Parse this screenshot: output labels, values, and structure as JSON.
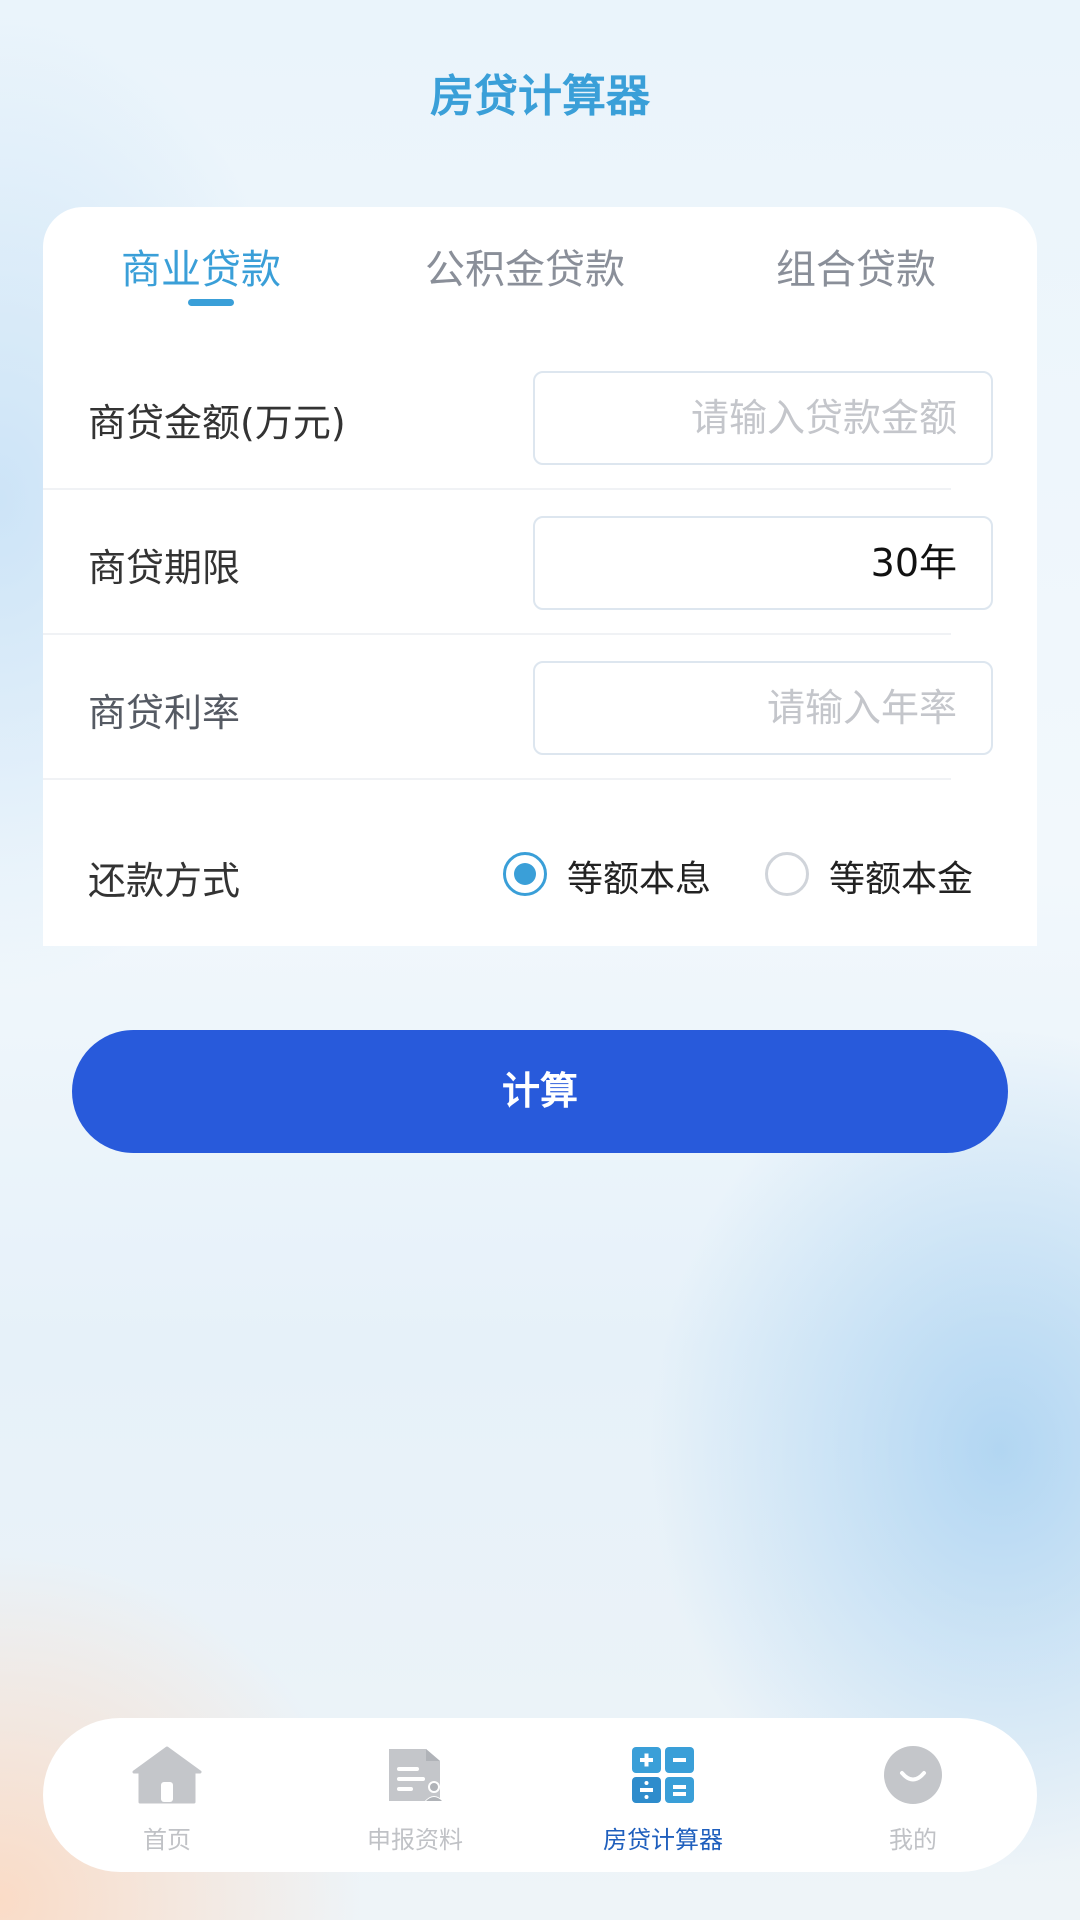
{
  "header": {
    "title": "房贷计算器"
  },
  "tabs": [
    {
      "label": "商业贷款",
      "active": true
    },
    {
      "label": "公积金贷款",
      "active": false
    },
    {
      "label": "组合贷款",
      "active": false
    }
  ],
  "form": {
    "amount": {
      "label": "商贷金额(万元)",
      "value": "",
      "placeholder": "请输入贷款金额"
    },
    "term": {
      "label": "商贷期限",
      "value": "30年"
    },
    "rate": {
      "label": "商贷利率",
      "value": "",
      "placeholder": "请输入年率"
    },
    "repayment": {
      "label": "还款方式",
      "options": [
        {
          "label": "等额本息",
          "checked": true
        },
        {
          "label": "等额本金",
          "checked": false
        }
      ]
    }
  },
  "actions": {
    "calculate_label": "计算"
  },
  "tabbar": {
    "items": [
      {
        "label": "首页",
        "icon": "home-icon",
        "active": false
      },
      {
        "label": "申报资料",
        "icon": "document-icon",
        "active": false
      },
      {
        "label": "房贷计算器",
        "icon": "calculator-icon",
        "active": true
      },
      {
        "label": "我的",
        "icon": "profile-icon",
        "active": false
      }
    ]
  },
  "colors": {
    "accent": "#3a9fd8",
    "button": "#285adb",
    "tabbar_active": "#1f5fbd",
    "tabbar_inactive": "#c0c2c6"
  }
}
